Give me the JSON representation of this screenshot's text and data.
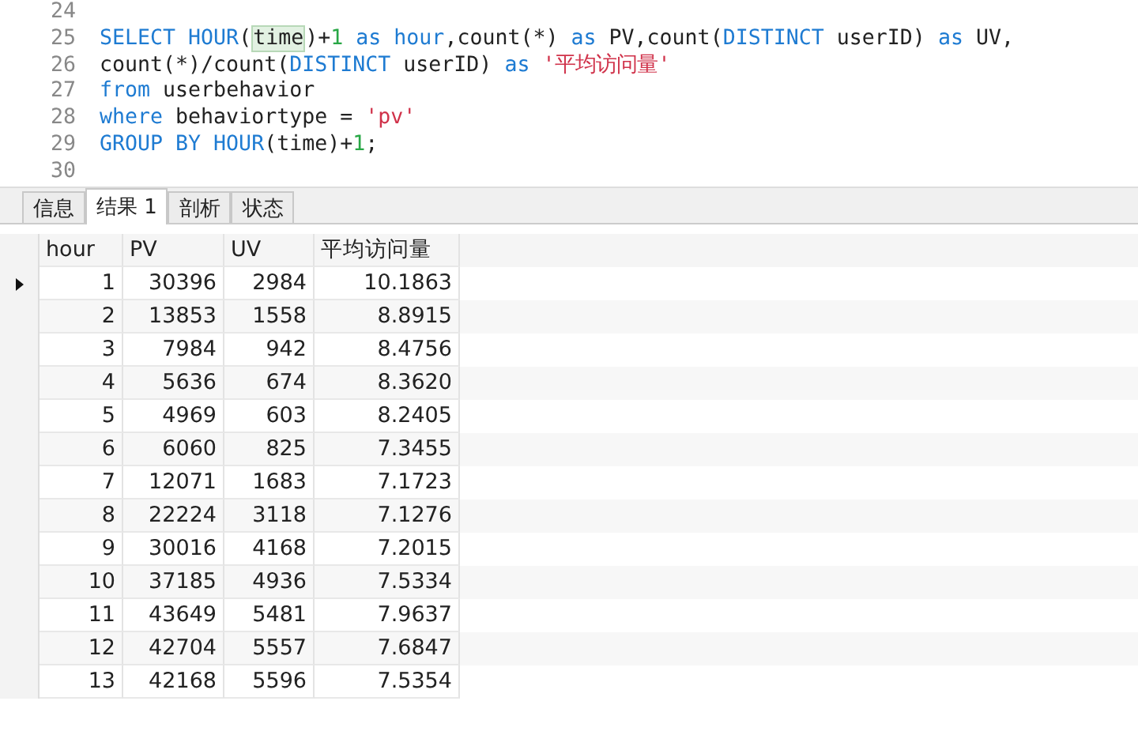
{
  "editor": {
    "lines": [
      {
        "number": "24"
      },
      {
        "number": "25",
        "tokens": [
          {
            "text": "SELECT HOUR",
            "kind": "keyword"
          },
          {
            "text": "(",
            "kind": "plain"
          },
          {
            "text": "time",
            "kind": "match"
          },
          {
            "text": ")+",
            "kind": "plain"
          },
          {
            "text": "1",
            "kind": "number"
          },
          {
            "text": " as hour",
            "kind": "keyword"
          },
          {
            "text": ",count(*) ",
            "kind": "plain"
          },
          {
            "text": "as",
            "kind": "keyword"
          },
          {
            "text": " PV,count(",
            "kind": "plain"
          },
          {
            "text": "DISTINCT",
            "kind": "keyword"
          },
          {
            "text": " userID) ",
            "kind": "plain"
          },
          {
            "text": "as",
            "kind": "keyword"
          },
          {
            "text": " UV,",
            "kind": "plain"
          }
        ]
      },
      {
        "number": "26",
        "tokens": [
          {
            "text": "count(*)/count(",
            "kind": "plain"
          },
          {
            "text": "DISTINCT",
            "kind": "keyword"
          },
          {
            "text": " userID) ",
            "kind": "plain"
          },
          {
            "text": "as ",
            "kind": "keyword"
          },
          {
            "text": "'平均访问量'",
            "kind": "string"
          }
        ]
      },
      {
        "number": "27",
        "tokens": [
          {
            "text": "from",
            "kind": "keyword"
          },
          {
            "text": " userbehavior",
            "kind": "plain"
          }
        ]
      },
      {
        "number": "28",
        "tokens": [
          {
            "text": "where",
            "kind": "keyword"
          },
          {
            "text": " behaviortype = ",
            "kind": "plain"
          },
          {
            "text": "'pv'",
            "kind": "string"
          }
        ]
      },
      {
        "number": "29",
        "tokens": [
          {
            "text": "GROUP BY HOUR",
            "kind": "keyword"
          },
          {
            "text": "(time)+",
            "kind": "plain"
          },
          {
            "text": "1",
            "kind": "number"
          },
          {
            "text": ";",
            "kind": "plain"
          }
        ]
      },
      {
        "number": "30"
      }
    ]
  },
  "tabs": [
    {
      "label": "信息",
      "selected": false
    },
    {
      "label": "结果 1",
      "selected": true
    },
    {
      "label": "剖析",
      "selected": false
    },
    {
      "label": "状态",
      "selected": false
    }
  ],
  "table": {
    "columns": [
      "hour",
      "PV",
      "UV",
      "平均访问量"
    ],
    "rows": [
      {
        "selected": true,
        "cells": [
          "1",
          "30396",
          "2984",
          "10.1863"
        ]
      },
      {
        "selected": false,
        "cells": [
          "2",
          "13853",
          "1558",
          "8.8915"
        ]
      },
      {
        "selected": false,
        "cells": [
          "3",
          "7984",
          "942",
          "8.4756"
        ]
      },
      {
        "selected": false,
        "cells": [
          "4",
          "5636",
          "674",
          "8.3620"
        ]
      },
      {
        "selected": false,
        "cells": [
          "5",
          "4969",
          "603",
          "8.2405"
        ]
      },
      {
        "selected": false,
        "cells": [
          "6",
          "6060",
          "825",
          "7.3455"
        ]
      },
      {
        "selected": false,
        "cells": [
          "7",
          "12071",
          "1683",
          "7.1723"
        ]
      },
      {
        "selected": false,
        "cells": [
          "8",
          "22224",
          "3118",
          "7.1276"
        ]
      },
      {
        "selected": false,
        "cells": [
          "9",
          "30016",
          "4168",
          "7.2015"
        ]
      },
      {
        "selected": false,
        "cells": [
          "10",
          "37185",
          "4936",
          "7.5334"
        ]
      },
      {
        "selected": false,
        "cells": [
          "11",
          "43649",
          "5481",
          "7.9637"
        ]
      },
      {
        "selected": false,
        "cells": [
          "12",
          "42704",
          "5557",
          "7.6847"
        ]
      },
      {
        "selected": false,
        "cells": [
          "13",
          "42168",
          "5596",
          "7.5354"
        ]
      }
    ]
  }
}
